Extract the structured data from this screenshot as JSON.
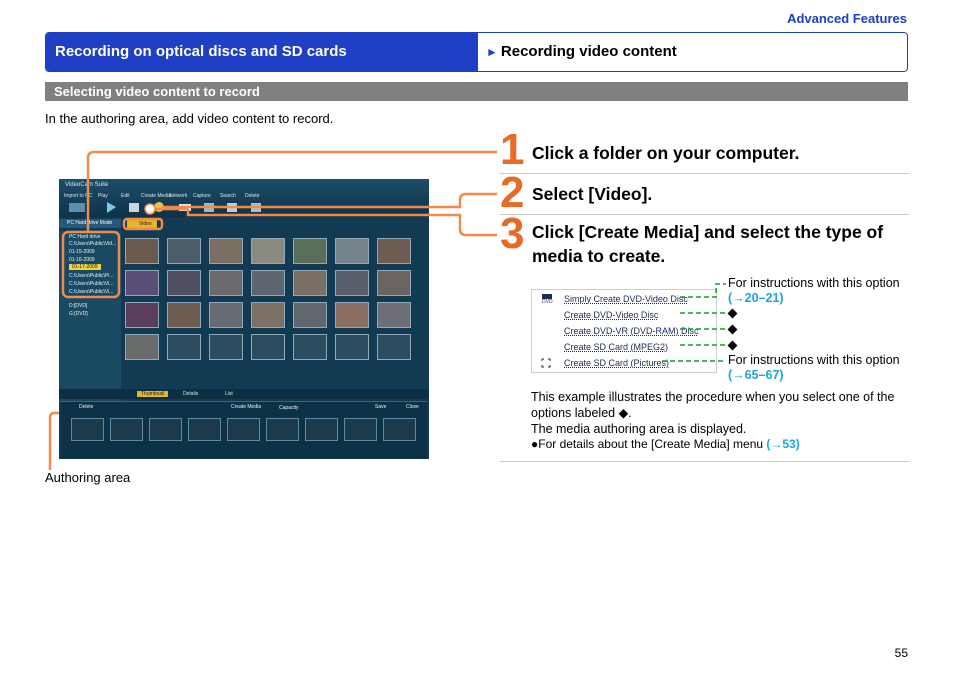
{
  "header": {
    "category": "Advanced Features",
    "section_title": "Recording on optical discs and SD cards",
    "subsection_marker": "►",
    "subsection_title": "Recording video content"
  },
  "section_bar": "Selecting video content to record",
  "intro": "In the authoring area, add video content to record.",
  "steps": [
    {
      "number": "1",
      "text": "Click a folder on your computer."
    },
    {
      "number": "2",
      "text": "Select [Video]."
    },
    {
      "number": "3",
      "text": "Click [Create Media] and select the type of media to create."
    }
  ],
  "media_menu": {
    "items": [
      "Simply Create DVD-Video Disc",
      "Create DVD-Video Disc",
      "Create DVD-VR (DVD-RAM) Disc",
      "Create SD Card (MPEG2)",
      "Create SD Card (Pictures)"
    ]
  },
  "notes": {
    "top_prefix": "For instructions with this option",
    "top_ref": "(→20–21)",
    "bottom_prefix": "For instructions with this option",
    "bottom_ref": "(→65–67)"
  },
  "body": {
    "line1": "This example illustrates the procedure when you select one of the options labeled ◆.",
    "line2": "The media authoring area is displayed.",
    "bullet_prefix": "●For details about the [Create Media] menu ",
    "bullet_ref": "(→53)"
  },
  "screenshot": {
    "app_title": "VideoCam Suite",
    "menus": [
      "Import to PC",
      "Play",
      "Edit",
      "Create Media",
      "Network",
      "Capture",
      "Search",
      "Delete"
    ],
    "mode_label": "PC Hard drive Mode",
    "video_tab": "Video",
    "tree": [
      "PC Hard drive",
      "C:\\Users\\Public\\Vid...",
      "01-15-2009",
      "01-16-2009",
      "01-17-2009",
      "C:\\Users\\Public\\Pi...",
      "C:\\Users\\Public\\Vi...",
      "C:\\Users\\Public\\Vi...",
      "D:[DVD]",
      "G:[DVD]"
    ],
    "view_tabs": [
      "Thumbnail",
      "Details",
      "List"
    ],
    "bottom_buttons": [
      "Delete",
      "Create Media",
      "Capacity",
      "Save",
      "Close"
    ]
  },
  "caption": "Authoring area",
  "page_number": "55",
  "colors": {
    "brand_blue": "#1f3fc5",
    "step_orange": "#e86a24",
    "link_cyan": "#1aa6d8",
    "callout_green": "#1a9a2a"
  }
}
